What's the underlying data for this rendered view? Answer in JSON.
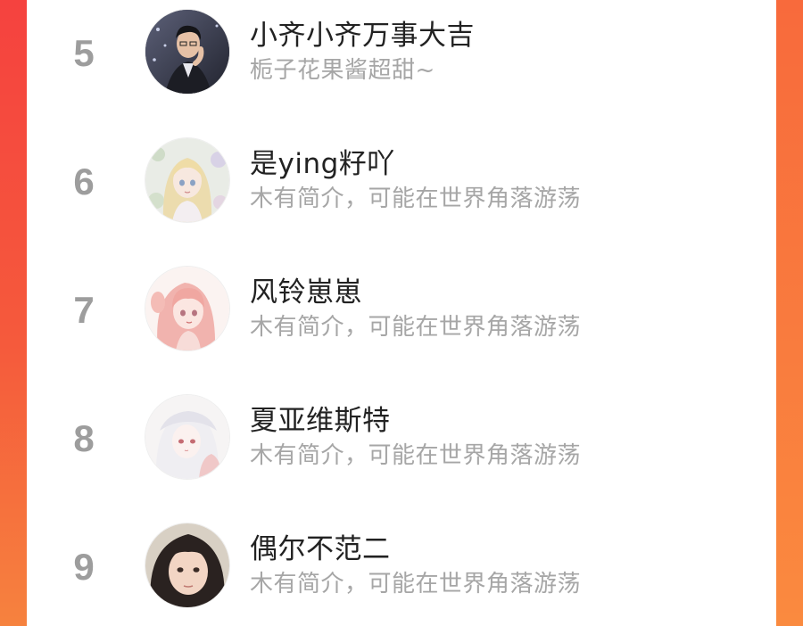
{
  "ranking": {
    "items": [
      {
        "rank": "5",
        "name": "小齐小齐万事大吉",
        "bio": "栀子花果酱超甜~",
        "avatar": "avatar-man-suit"
      },
      {
        "rank": "6",
        "name": "是ying籽吖",
        "bio": "木有简介，可能在世界角落游荡",
        "avatar": "avatar-anime-blonde-girl"
      },
      {
        "rank": "7",
        "name": "风铃崽崽",
        "bio": "木有简介，可能在世界角落游荡",
        "avatar": "avatar-anime-pink-girl"
      },
      {
        "rank": "8",
        "name": "夏亚维斯特",
        "bio": "木有简介，可能在世界角落游荡",
        "avatar": "avatar-anime-white-hair"
      },
      {
        "rank": "9",
        "name": "偶尔不范二",
        "bio": "木有简介，可能在世界角落游荡",
        "avatar": "avatar-girl-photo"
      }
    ]
  },
  "colors": {
    "background_left": "#f5423f",
    "background_right": "#fa8a3f",
    "card": "#ffffff",
    "rank_number": "#9d9d9d",
    "name_text": "#222222",
    "bio_text": "#a6a6a6"
  }
}
